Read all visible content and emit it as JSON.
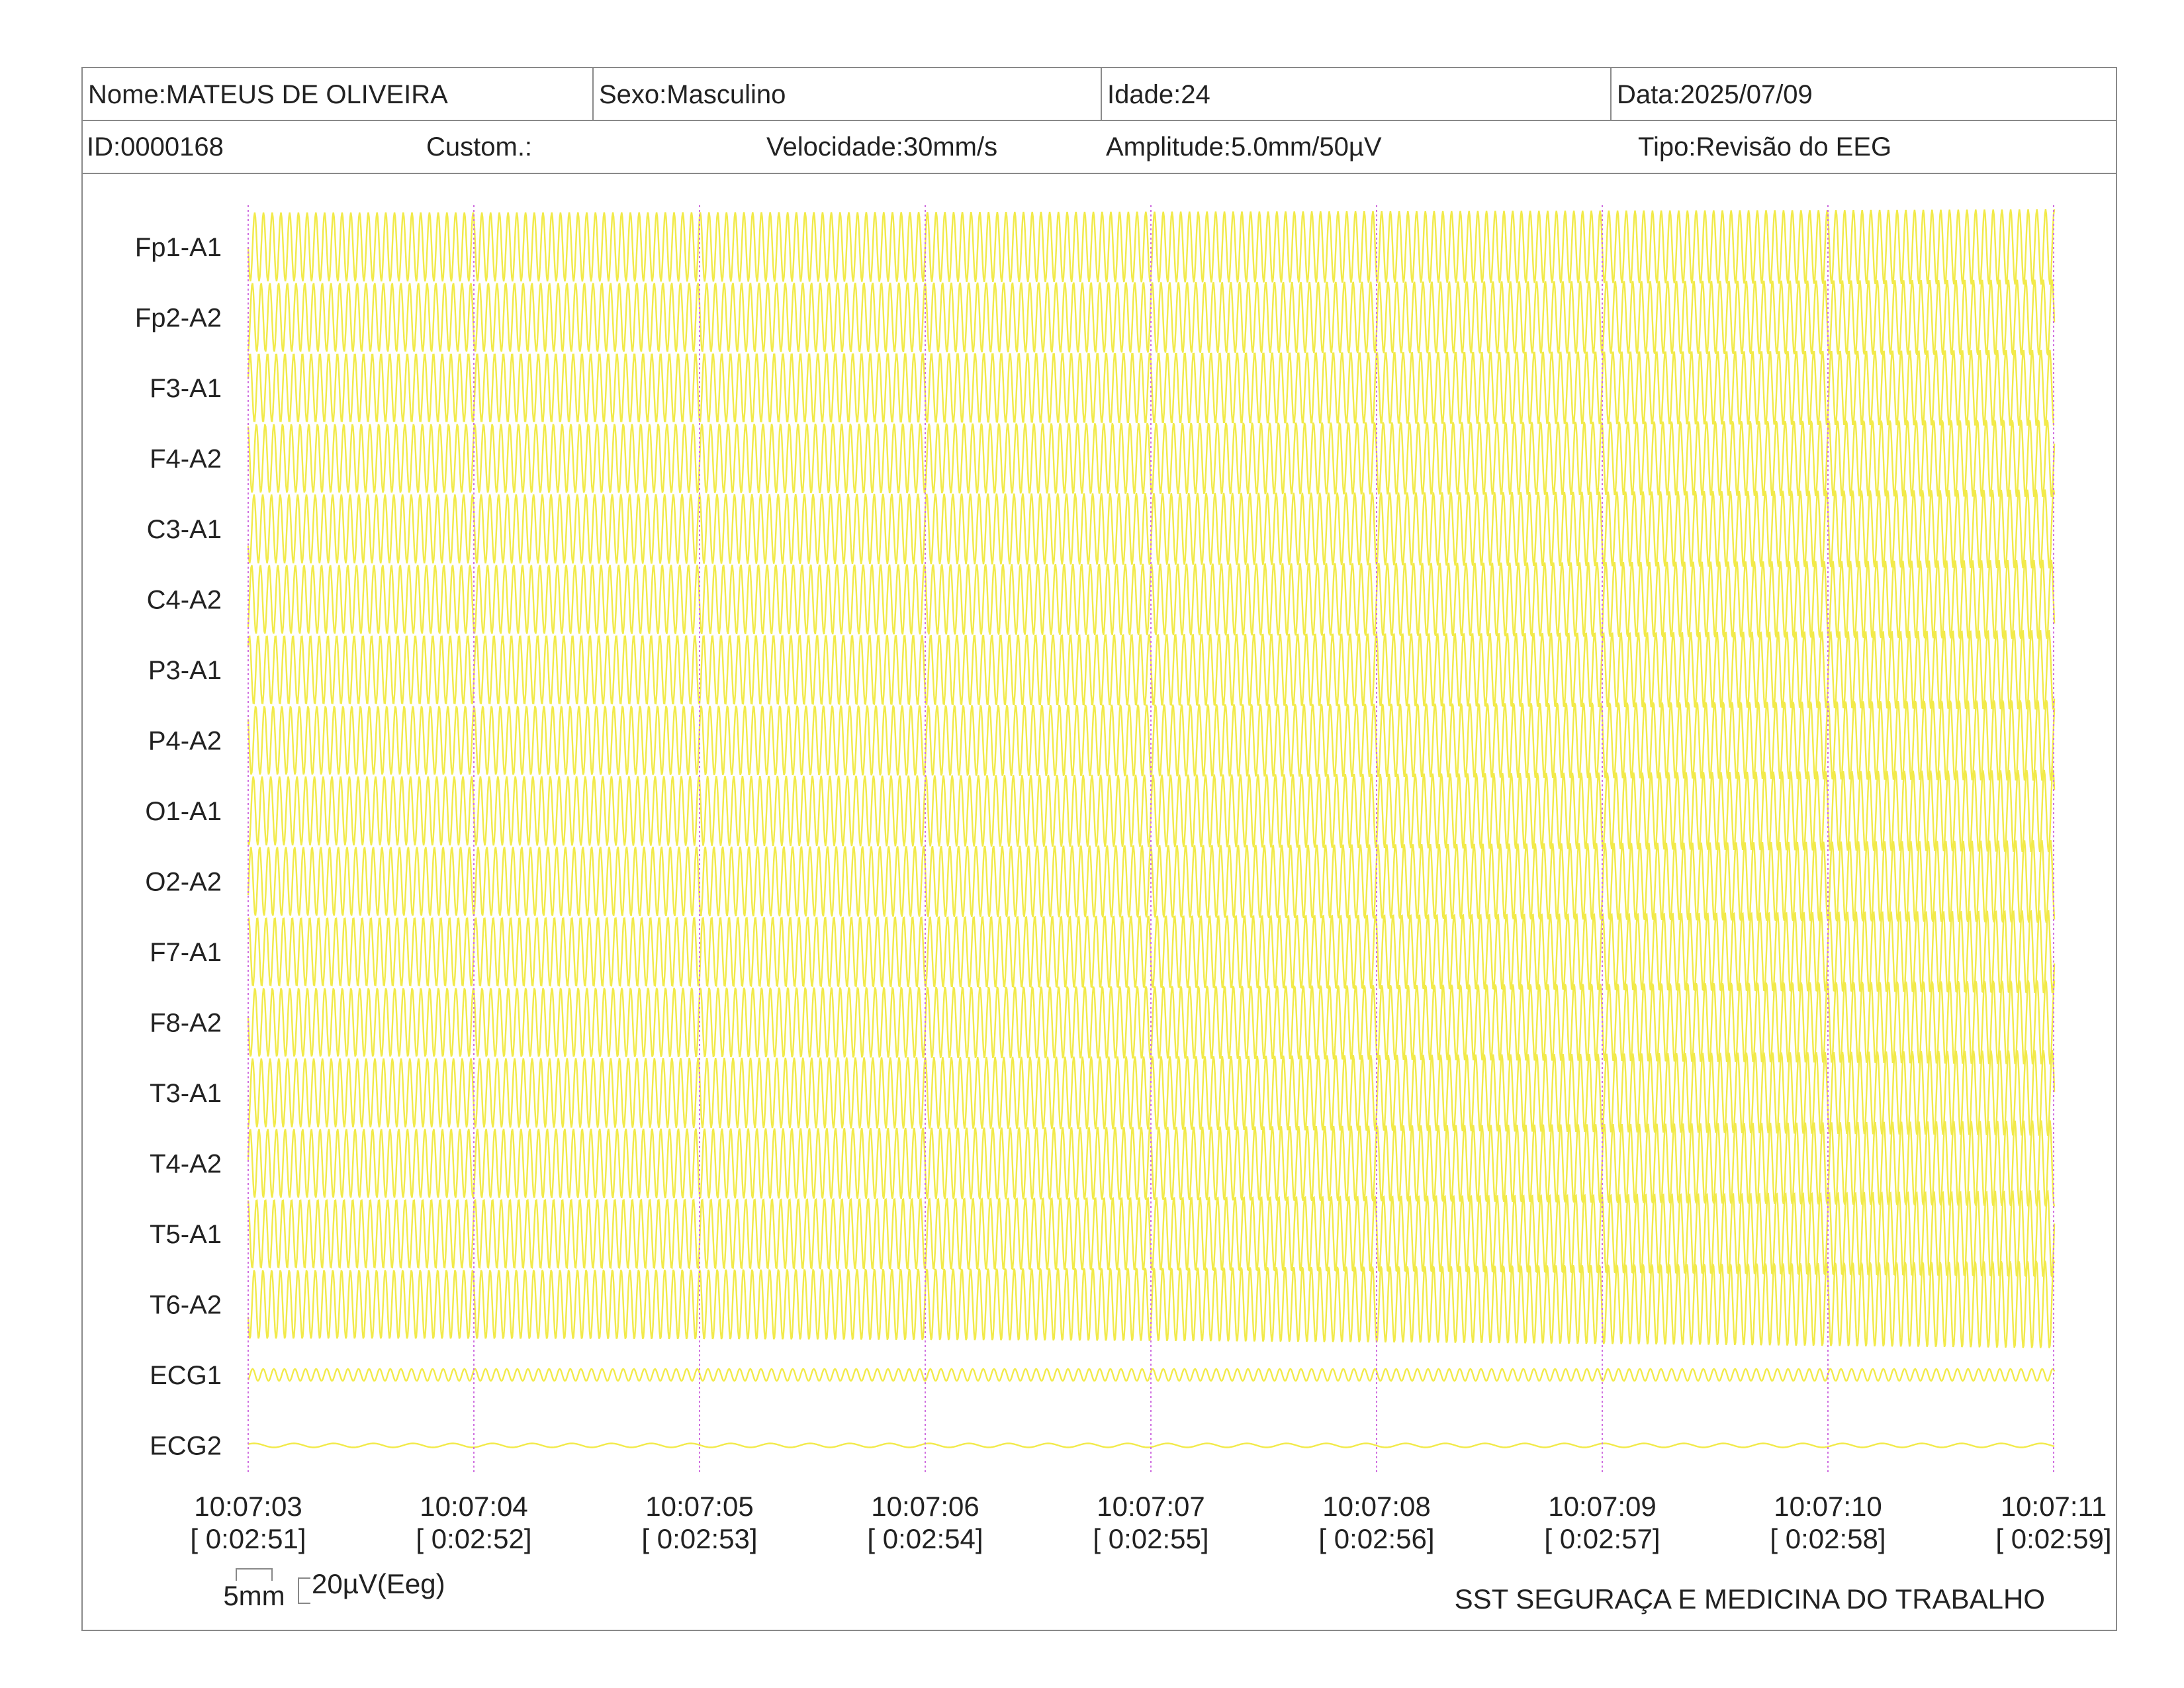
{
  "header": {
    "name": "Nome:MATEUS DE OLIVEIRA",
    "sex": "Sexo:Masculino",
    "age": "Idade:24",
    "date": "Data:2025/07/09",
    "id": "ID:0000168",
    "custom": "Custom.:",
    "speed": "Velocidade:30mm/s",
    "amplitude": "Amplitude:5.0mm/50µV",
    "type": "Tipo:Revisão do EEG"
  },
  "colors": {
    "trace": "#f2ea4a",
    "marker": "#d070e0",
    "text": "#222222",
    "border": "#8a8a8a"
  },
  "chart_data": {
    "type": "line",
    "channels": [
      "Fp1-A1",
      "Fp2-A2",
      "F3-A1",
      "F4-A2",
      "C3-A1",
      "C4-A2",
      "P3-A1",
      "P4-A2",
      "O1-A1",
      "O2-A2",
      "F7-A1",
      "F8-A2",
      "T3-A1",
      "T4-A2",
      "T5-A1",
      "T6-A2",
      "ECG1",
      "ECG2"
    ],
    "x_ticks": [
      {
        "time": "10:07:03",
        "elapsed": "[ 0:02:51]"
      },
      {
        "time": "10:07:04",
        "elapsed": "[ 0:02:52]"
      },
      {
        "time": "10:07:05",
        "elapsed": "[ 0:02:53]"
      },
      {
        "time": "10:07:06",
        "elapsed": "[ 0:02:54]"
      },
      {
        "time": "10:07:07",
        "elapsed": "[ 0:02:55]"
      },
      {
        "time": "10:07:08",
        "elapsed": "[ 0:02:56]"
      },
      {
        "time": "10:07:09",
        "elapsed": "[ 0:02:57]"
      },
      {
        "time": "10:07:10",
        "elapsed": "[ 0:02:58]"
      },
      {
        "time": "10:07:11",
        "elapsed": "[ 0:02:59]"
      }
    ],
    "grid": "dotted vertical markers at each second",
    "scale_bar": {
      "time_label": "5mm",
      "amp_label": "20µV(Eeg)"
    }
  },
  "footer": {
    "company": "SST SEGURAÇA E MEDICINA DO TRABALHO"
  }
}
